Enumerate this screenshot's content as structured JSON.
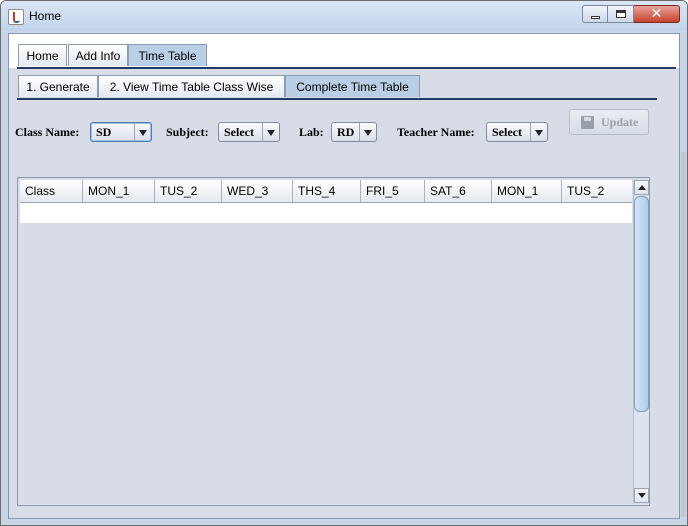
{
  "window": {
    "title": "Home"
  },
  "main_tabs": [
    {
      "label": "Home",
      "active": false
    },
    {
      "label": "Add Info",
      "active": false
    },
    {
      "label": "Time Table",
      "active": true
    }
  ],
  "sub_tabs": [
    {
      "label": "1. Generate",
      "active": false
    },
    {
      "label": "2. View Time Table Class Wise",
      "active": false
    },
    {
      "label": "Complete Time Table",
      "active": true
    }
  ],
  "filters": {
    "class_name": {
      "label": "Class Name:",
      "value": "SD"
    },
    "subject": {
      "label": "Subject:",
      "value": "Select"
    },
    "lab": {
      "label": "Lab:",
      "value": "RD"
    },
    "teacher_name": {
      "label": "Teacher Name:",
      "value": "Select"
    }
  },
  "update_button": {
    "label": "Update",
    "enabled": false,
    "icon": "floppy-disk-icon"
  },
  "table": {
    "columns": [
      "Class",
      "MON_1",
      "TUS_2",
      "WED_3",
      "THS_4",
      "FRI_5",
      "SAT_6",
      "MON_1",
      "TUS_2"
    ],
    "rows": []
  },
  "colors": {
    "tab_active": "#b8cfe5",
    "panel_bg": "#d7dce7",
    "tab_rule": "#253a68",
    "close_button": "#c7402b"
  }
}
